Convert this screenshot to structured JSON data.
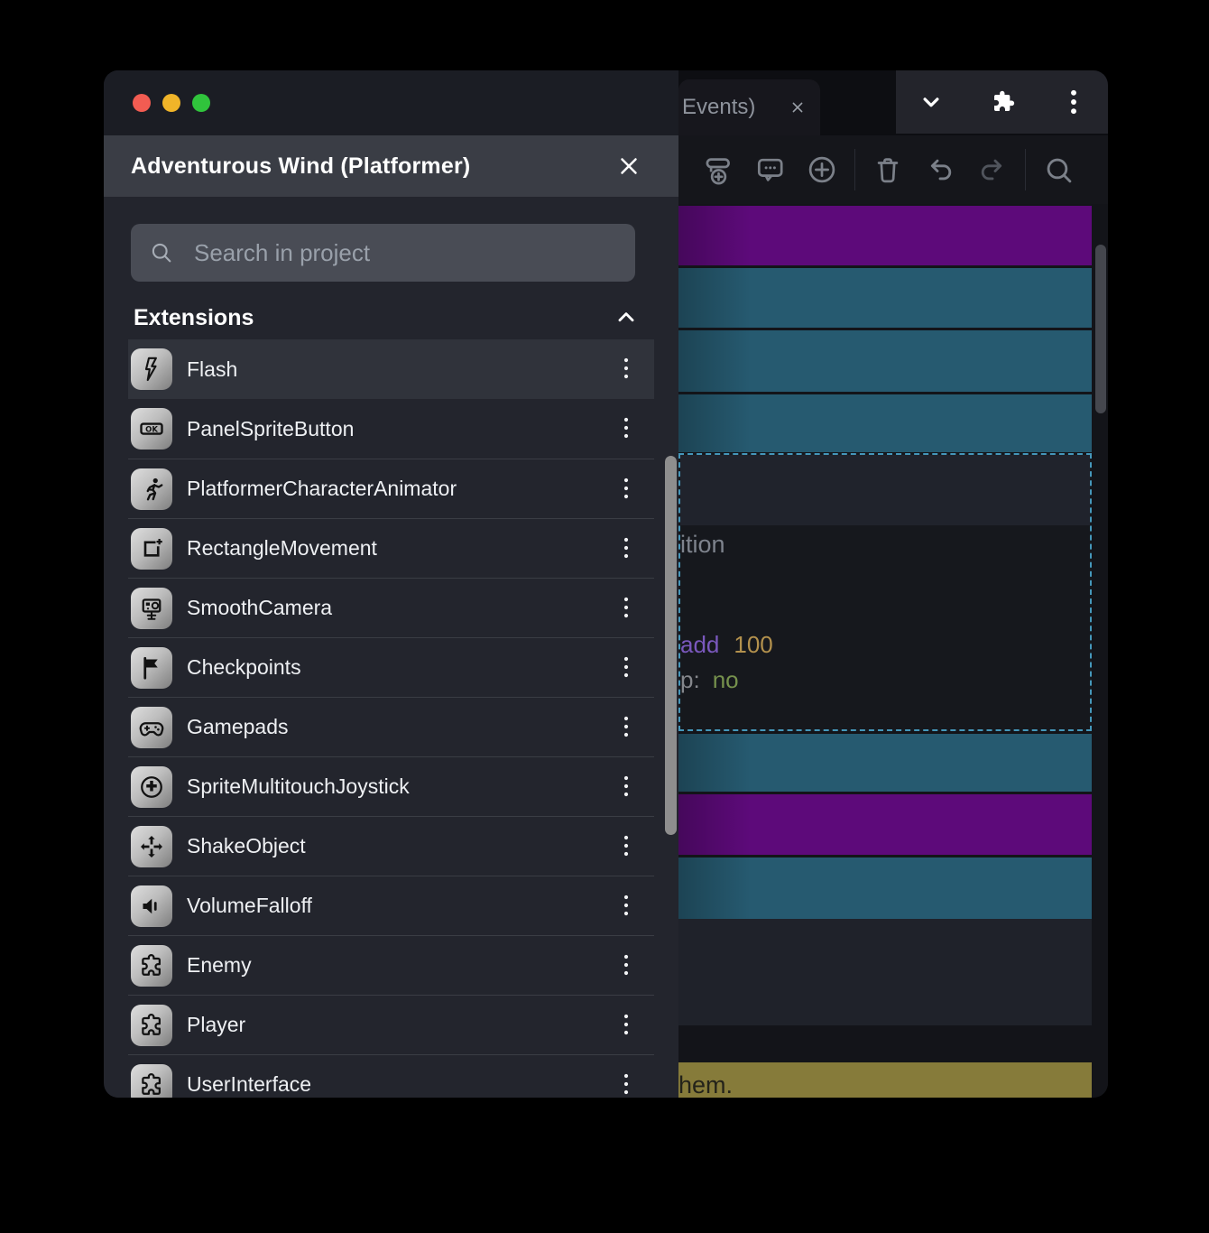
{
  "macos_window_controls": {
    "close": "red",
    "minimize": "yellow",
    "zoom": "green"
  },
  "project_manager": {
    "title": "Adventurous Wind (Platformer)",
    "close_icon": "close-x-icon",
    "search": {
      "placeholder": "Search in project",
      "value": ""
    },
    "section_header": {
      "label": "Extensions",
      "state": "expanded",
      "icon": "chevron-up-icon"
    },
    "extensions": [
      {
        "label": "Flash",
        "icon": "flash-icon",
        "menu_icon": "kebab-menu-icon",
        "highlighted": true
      },
      {
        "label": "PanelSpriteButton",
        "icon": "ok-button-icon",
        "menu_icon": "kebab-menu-icon"
      },
      {
        "label": "PlatformerCharacterAnimator",
        "icon": "runner-icon",
        "menu_icon": "kebab-menu-icon"
      },
      {
        "label": "RectangleMovement",
        "icon": "rectangle-add-icon",
        "menu_icon": "kebab-menu-icon"
      },
      {
        "label": "SmoothCamera",
        "icon": "camera-icon",
        "menu_icon": "kebab-menu-icon"
      },
      {
        "label": "Checkpoints",
        "icon": "flag-icon",
        "menu_icon": "kebab-menu-icon"
      },
      {
        "label": "Gamepads",
        "icon": "gamepad-icon",
        "menu_icon": "kebab-menu-icon"
      },
      {
        "label": "SpriteMultitouchJoystick",
        "icon": "joystick-icon",
        "menu_icon": "kebab-menu-icon"
      },
      {
        "label": "ShakeObject",
        "icon": "move-arrows-icon",
        "menu_icon": "kebab-menu-icon"
      },
      {
        "label": "VolumeFalloff",
        "icon": "speaker-icon",
        "menu_icon": "kebab-menu-icon"
      },
      {
        "label": "Enemy",
        "icon": "puzzle-icon",
        "menu_icon": "kebab-menu-icon"
      },
      {
        "label": "Player",
        "icon": "puzzle-icon",
        "menu_icon": "kebab-menu-icon"
      },
      {
        "label": "UserInterface",
        "icon": "puzzle-icon",
        "menu_icon": "kebab-menu-icon"
      }
    ]
  },
  "events_editor": {
    "tab": {
      "label": "Events)",
      "close_icon": "close-x-icon"
    },
    "window_menu_icons": [
      "chevron-down-icon",
      "extensions-puzzle-icon",
      "kebab-menu-icon"
    ],
    "toolbar_icons": [
      "add-sub-event-icon",
      "add-comment-icon",
      "add-event-icon",
      "delete-icon",
      "undo-icon",
      "redo-icon",
      "search-icon"
    ],
    "selected_event": {
      "condition_fragment": "ition",
      "action_fragments": {
        "keyword": "add",
        "value": "100",
        "param": "p:",
        "param_value": "no"
      }
    },
    "comment_fragment": "hem."
  },
  "colors": {
    "event_purple": "#5d0a7a",
    "event_teal": "#265a70",
    "comment_olive": "#867b3a",
    "selection_dash": "#4597ba",
    "keyword_purple": "#7a58bd",
    "number_gold": "#b3914d",
    "param_gray": "#85878c",
    "value_green": "#76914d",
    "traffic_red": "#f25c52",
    "traffic_yellow": "#f0b429",
    "traffic_green": "#30c43c"
  }
}
